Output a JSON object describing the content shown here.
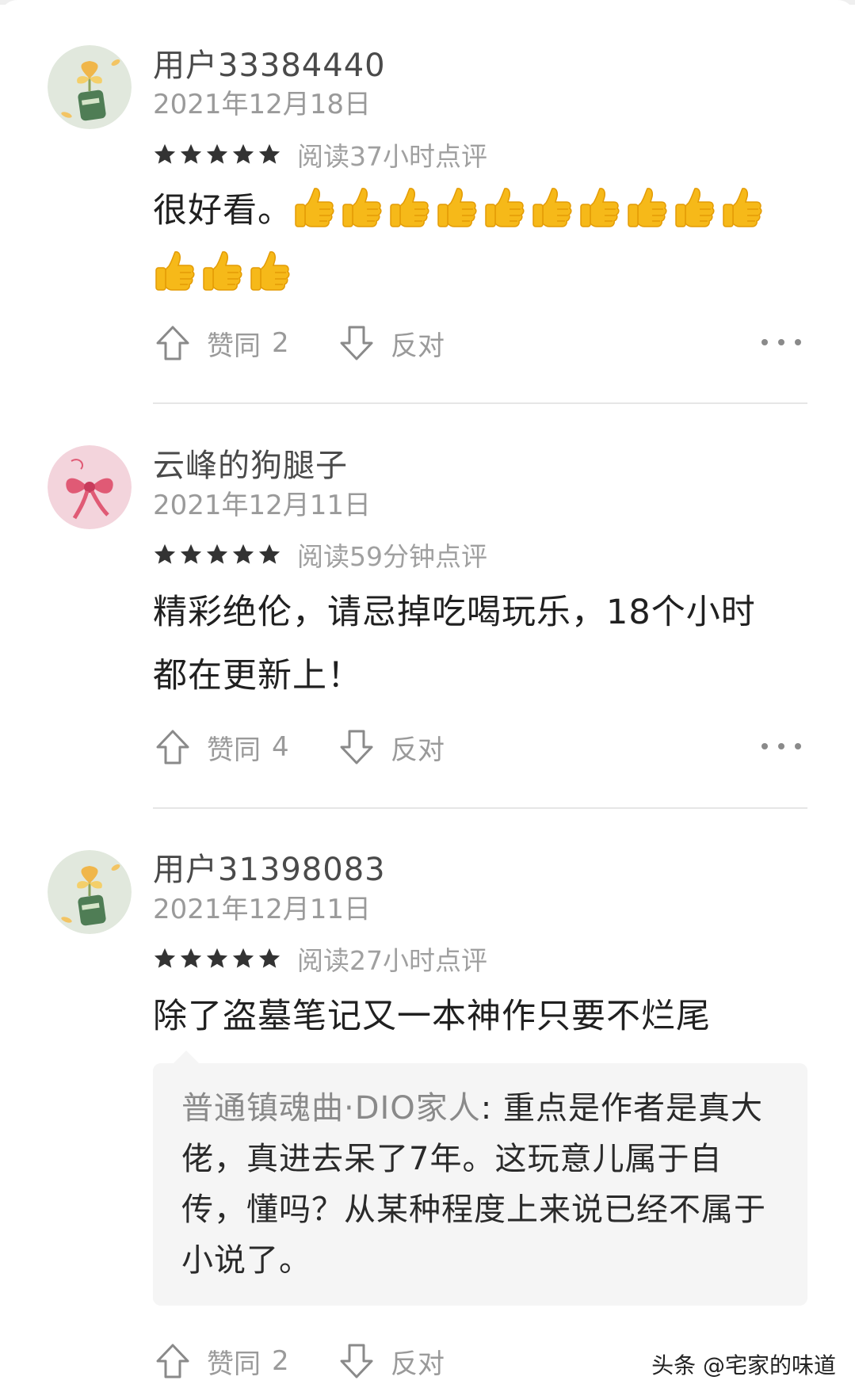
{
  "comments": [
    {
      "username": "用户33384440",
      "date": "2021年12月18日",
      "stars": 5,
      "read_note": "阅读37小时点评",
      "content": "很好看。",
      "thumbs_up_emoji_count": 13,
      "agree_label": "赞同",
      "agree_count": "2",
      "oppose_label": "反对",
      "avatar": "ginkgo-flower-avatar"
    },
    {
      "username": "云峰的狗腿子",
      "date": "2021年12月11日",
      "stars": 5,
      "read_note": "阅读59分钟点评",
      "content_line1": "精彩绝伦，请忌掉吃喝玩乐，18个小时",
      "content_line2": "都在更新上！",
      "agree_label": "赞同",
      "agree_count": "4",
      "oppose_label": "反对",
      "avatar": "pink-bow-avatar"
    },
    {
      "username": "用户31398083",
      "date": "2021年12月11日",
      "stars": 5,
      "read_note": "阅读27小时点评",
      "content": "除了盗墓笔记又一本神作只要不烂尾",
      "reply": {
        "author": "普通镇魂曲·DIO家人",
        "separator": ": ",
        "text_line1": "重点是作者是真大",
        "text_line2": "佬，真进去呆了7年。这玩意儿属于自",
        "text_line3": "传，懂吗？从某种程度上来说已经不属于",
        "text_line4": "小说了。"
      },
      "agree_label": "赞同",
      "agree_count": "2",
      "oppose_label": "反对",
      "avatar": "ginkgo-flower-avatar"
    }
  ],
  "watermark": "头条 @宅家的味道",
  "colors": {
    "username": "#4a4a4a",
    "meta": "#9a9a9a",
    "emoji": "#f6b919",
    "reply_bg": "#f5f5f5"
  }
}
